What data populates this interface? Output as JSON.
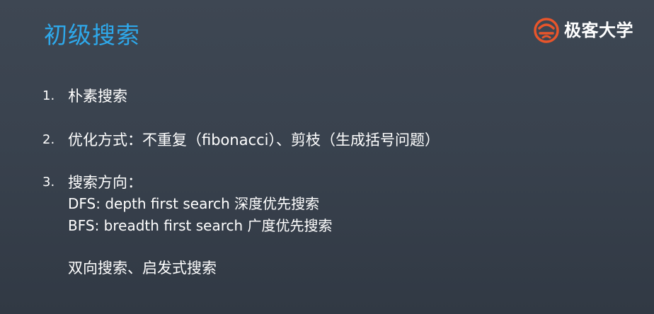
{
  "slide": {
    "title": "初级搜索"
  },
  "brand": {
    "icon": "geekbang-logo-icon",
    "name": "极客大学",
    "color": "#e8552b"
  },
  "list": {
    "items": [
      {
        "number": "1.",
        "text": "朴素搜索"
      },
      {
        "number": "2.",
        "text": "优化方式：不重复（fibonacci）、剪枝（生成括号问题）"
      },
      {
        "number": "3.",
        "text": "搜索方向："
      }
    ],
    "directions": [
      "DFS: depth first search 深度优先搜索",
      "BFS: breadth first search 广度优先搜索"
    ],
    "extra": "双向搜索、启发式搜索"
  },
  "colors": {
    "title": "#2ea8ea",
    "text": "#ffffff",
    "background": "#39424e"
  }
}
